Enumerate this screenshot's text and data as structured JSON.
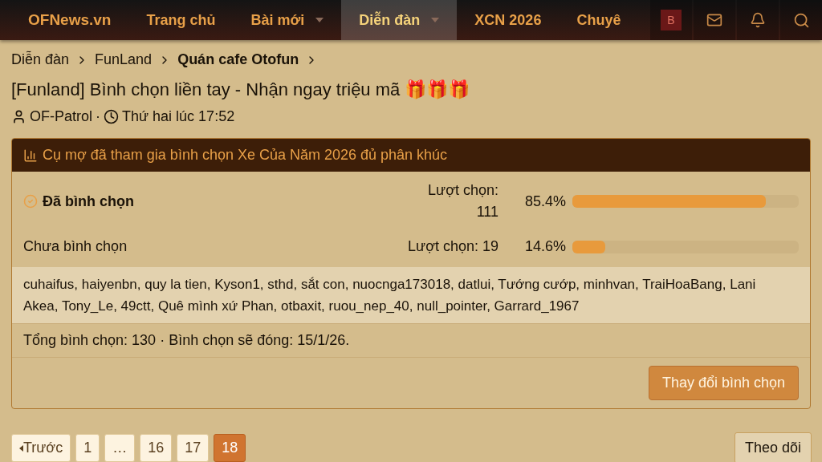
{
  "nav": {
    "logo": "OFNews.vn",
    "items": [
      {
        "label": "Trang chủ",
        "dropdown": false,
        "selected": false
      },
      {
        "label": "Bài mới",
        "dropdown": true,
        "selected": false
      },
      {
        "label": "Diễn đàn",
        "dropdown": true,
        "selected": true
      },
      {
        "label": "XCN 2026",
        "dropdown": false,
        "selected": false
      },
      {
        "label": "Chuyê",
        "dropdown": false,
        "selected": false
      }
    ],
    "avatar": "B"
  },
  "breadcrumb": [
    {
      "label": "Diễn đàn",
      "current": false
    },
    {
      "label": "FunLand",
      "current": false
    },
    {
      "label": "Quán cafe Otofun",
      "current": true
    }
  ],
  "thread": {
    "title": "[Funland] Bình chọn liền tay - Nhận ngay triệu mã 🎁🎁🎁",
    "author": "OF-Patrol",
    "separator": "·",
    "time": "Thứ hai lúc 17:52"
  },
  "poll": {
    "title": "Cụ mợ đã tham gia bình chọn Xe Của Năm 2026 đủ phân khúc",
    "options": [
      {
        "label": "Đã bình chọn",
        "chosen": true,
        "votes": "Lượt chọn: 111",
        "percent": "85.4%",
        "level": 0.854
      },
      {
        "label": "Chưa bình chọn",
        "chosen": false,
        "votes": "Lượt chọn: 19",
        "percent": "14.6%",
        "level": 0.146
      }
    ],
    "voters": "cuhaifus, haiyenbn, quy la tien, Kyson1, sthd, sắt con, nuocnga173018, datlui, Tướng cướp, minhvan, TraiHoaBang, Lani Akea, Tony_Le, 49ctt, Quê mình xứ Phan, otbaxit, ruou_nep_40, null_pointer, Garrard_1967",
    "summary": "Tổng bình chọn: 130 · Bình chọn sẽ đóng: 15/1/26.",
    "button": "Thay đổi bình chọn"
  },
  "pagination": {
    "prev": "Trước",
    "pages": [
      {
        "label": "1",
        "selected": false
      },
      {
        "label": "…",
        "selected": false
      },
      {
        "label": "16",
        "selected": false
      },
      {
        "label": "17",
        "selected": false
      },
      {
        "label": "18",
        "selected": true
      }
    ]
  },
  "watch_button": "Theo dõi"
}
